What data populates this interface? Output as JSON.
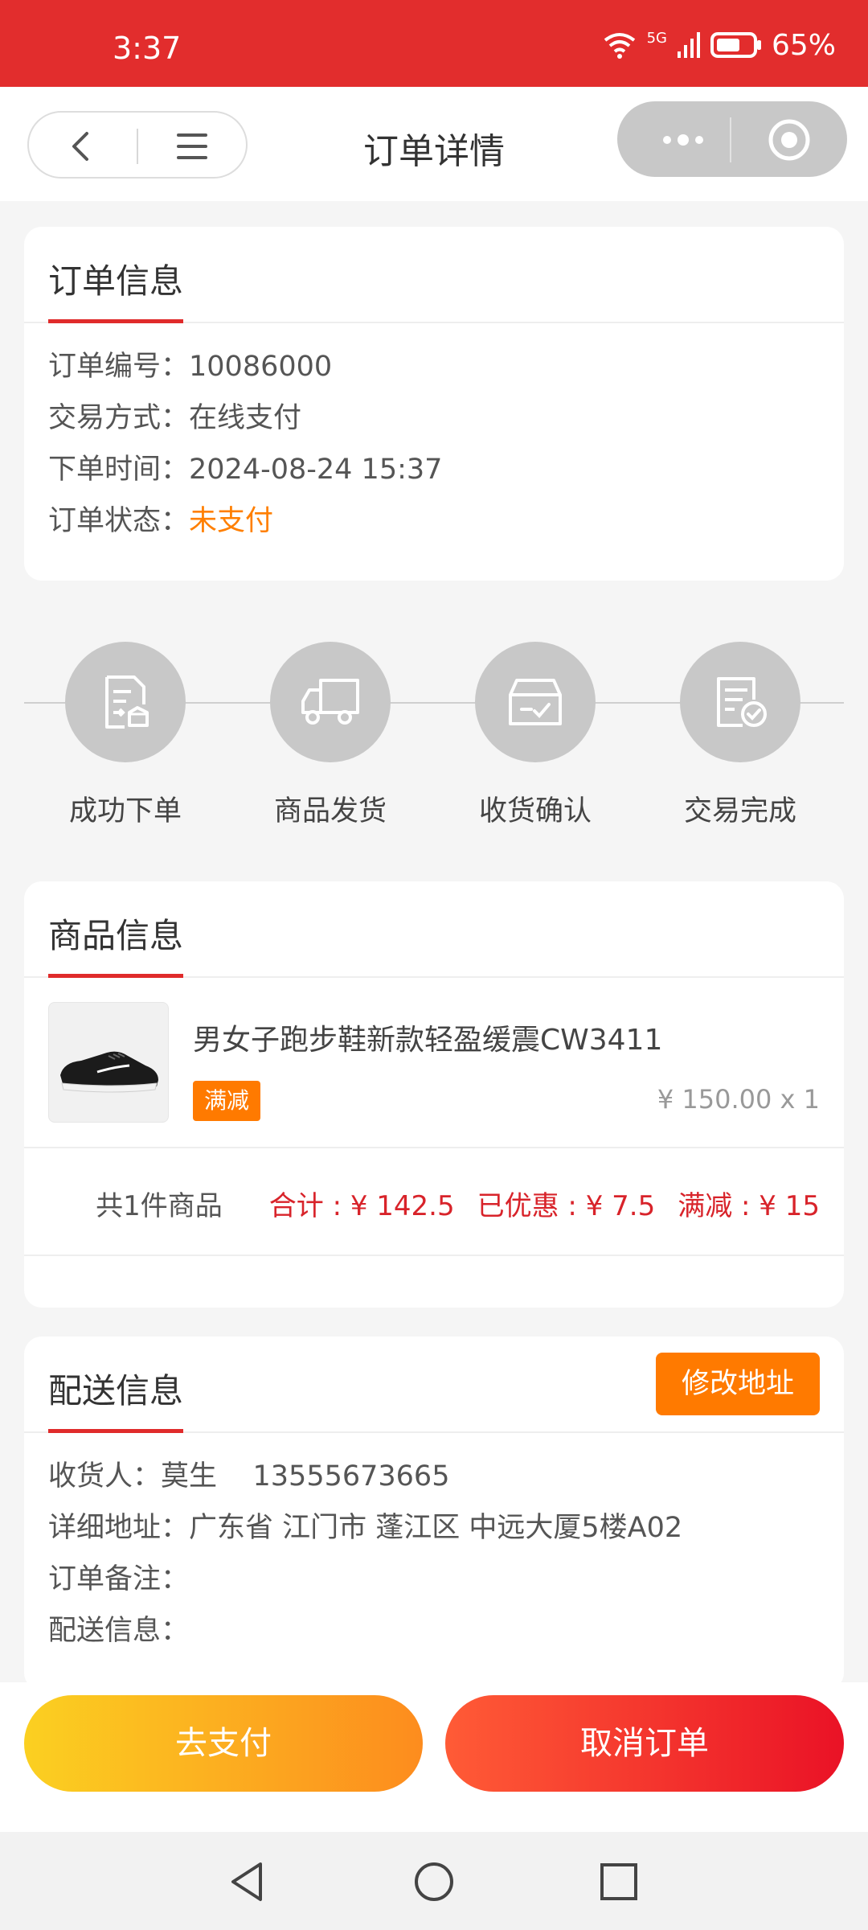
{
  "status_bar": {
    "time": "3:37",
    "network": "5G",
    "battery": "65%",
    "icons": [
      "wifi-icon",
      "signal-icon",
      "battery-icon"
    ]
  },
  "header": {
    "title": "订单详情",
    "icons": [
      "back-icon",
      "menu-icon",
      "more-icon",
      "close-circle-icon"
    ]
  },
  "order_info": {
    "title": "订单信息",
    "rows": [
      {
        "label": "订单编号：",
        "value": "10086000"
      },
      {
        "label": "交易方式：",
        "value": "在线支付"
      },
      {
        "label": "下单时间：",
        "value": "2024-08-24 15:37"
      },
      {
        "label": "订单状态：",
        "value": "未支付"
      }
    ]
  },
  "steps": [
    {
      "label": "成功下单",
      "icon": "order-doc-icon"
    },
    {
      "label": "商品发货",
      "icon": "truck-icon"
    },
    {
      "label": "收货确认",
      "icon": "box-check-icon"
    },
    {
      "label": "交易完成",
      "icon": "doc-check-icon"
    }
  ],
  "goods_info": {
    "title": "商品信息",
    "product": {
      "name": "男女子跑步鞋新款轻盈缓震CW3411",
      "tag": "满减",
      "price": "¥ 150.00 x 1",
      "image_icon": "shoe-image"
    },
    "summary": {
      "count": "共1件商品",
      "total": "合计 : ¥ 142.5",
      "discount": "已优惠 : ¥ 7.5",
      "reduction": "满减 : ¥ 15"
    }
  },
  "delivery_info": {
    "title": "配送信息",
    "edit_button": "修改地址",
    "rows": [
      {
        "label": "收货人：",
        "value": "莫生    13555673665"
      },
      {
        "label": "详细地址：",
        "value": "广东省 江门市 蓬江区 中远大厦5楼A02"
      },
      {
        "label": "订单备注：",
        "value": ""
      },
      {
        "label": "配送信息：",
        "value": ""
      }
    ]
  },
  "actions": {
    "pay": "去支付",
    "cancel": "取消订单"
  },
  "colors": {
    "brand_red": "#e22d2d",
    "orange": "#ff7a00",
    "price_red": "#d8232a"
  }
}
